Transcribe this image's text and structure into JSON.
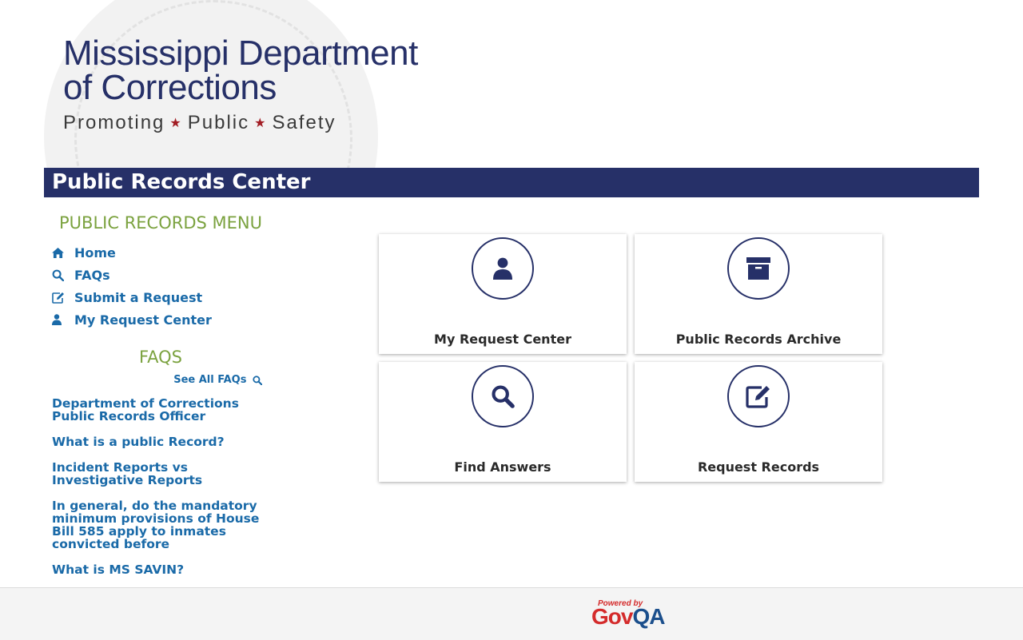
{
  "header": {
    "logo_line1": "Mississippi Department",
    "logo_line2": "of Corrections",
    "tagline": [
      "Promoting",
      "Public",
      "Safety"
    ]
  },
  "title_bar": {
    "title": "Public Records Center"
  },
  "sidebar": {
    "menu_title": "PUBLIC RECORDS MENU",
    "menu_items": [
      {
        "label": "Home",
        "icon": "home-icon"
      },
      {
        "label": "FAQs",
        "icon": "search-icon"
      },
      {
        "label": "Submit a Request",
        "icon": "edit-icon"
      },
      {
        "label": "My Request Center",
        "icon": "user-icon"
      }
    ],
    "faqs_title": "FAQS",
    "see_all_label": "See All FAQs",
    "faqs": [
      "Department of Corrections Public Records Officer",
      "What is a public Record?",
      "Incident Reports vs Investigative Reports",
      "In general, do the mandatory minimum provisions of House Bill 585 apply to inmates convicted before",
      "What is MS SAVIN?"
    ]
  },
  "cards": [
    {
      "label": "My Request Center",
      "icon": "user-icon"
    },
    {
      "label": "Public Records Archive",
      "icon": "archive-box-icon"
    },
    {
      "label": "Find Answers",
      "icon": "search-icon"
    },
    {
      "label": "Request Records",
      "icon": "edit-icon"
    }
  ],
  "footer": {
    "powered_by": "Powered by",
    "brand_gov": "Gov",
    "brand_qa": "QA"
  },
  "colors": {
    "navy": "#263068",
    "link_blue": "#1a6aa8",
    "heading_green": "#7ba23f",
    "star_red": "#a21d24"
  }
}
